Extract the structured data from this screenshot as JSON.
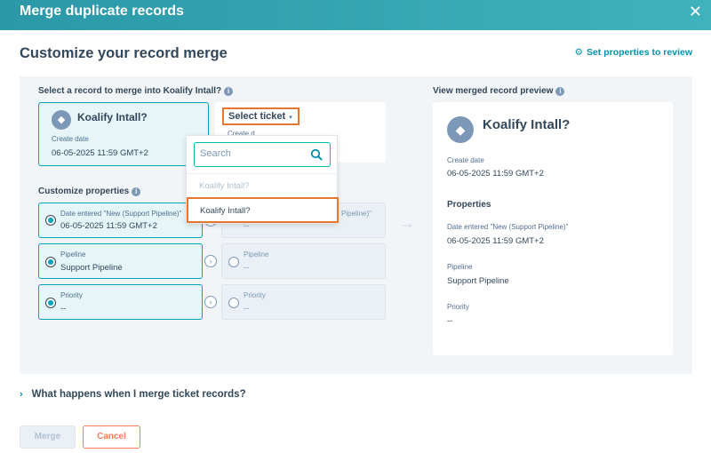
{
  "header": {
    "title": "Merge duplicate records",
    "close_glyph": "✕"
  },
  "page": {
    "title": "Customize your record merge",
    "set_properties_link": "Set properties to review",
    "gear_glyph": "⚙"
  },
  "select_section": {
    "label": "Select a record to merge into Koalify Intall?",
    "primary_record": {
      "title": "Koalify Intall?",
      "date_label": "Create date",
      "date_value": "06-05-2025 11:59 GMT+2"
    },
    "secondary_record": {
      "select_label": "Select ticket",
      "date_label_partial": "Create d"
    }
  },
  "dropdown": {
    "search_placeholder": "Search",
    "items": [
      {
        "label": "Koalify Intall?",
        "disabled": true
      },
      {
        "label": "Koalify Intall?",
        "highlighted": true
      }
    ]
  },
  "customize": {
    "label": "Customize properties",
    "rows": [
      {
        "label": "Date entered \"New (Support Pipeline)\"",
        "value": "06-05-2025 11:59 GMT+2",
        "other_label_partial": "Pipeline)\"",
        "other_value": "--"
      },
      {
        "label": "Pipeline",
        "value": "Support Pipeline",
        "other_label": "Pipeline",
        "other_value": "--"
      },
      {
        "label": "Priority",
        "value": "--",
        "other_label": "Priority",
        "other_value": "--"
      }
    ]
  },
  "preview": {
    "label": "View merged record preview",
    "title": "Koalify Intall?",
    "create_date_label": "Create date",
    "create_date_value": "06-05-2025 11:59 GMT+2",
    "properties_heading": "Properties",
    "props": [
      {
        "label": "Date entered \"New (Support Pipeline)\"",
        "value": "06-05-2025 11:59 GMT+2"
      },
      {
        "label": "Pipeline",
        "value": "Support Pipeline"
      },
      {
        "label": "Priority",
        "value": "--"
      }
    ]
  },
  "faq": {
    "text": "What happens when I merge ticket records?",
    "chevron": "›"
  },
  "footer": {
    "merge_label": "Merge",
    "cancel_label": "Cancel"
  },
  "icons": {
    "info": "i",
    "ticket": "◆",
    "arrow_right": "→",
    "chevron_right": "›",
    "caret_down": "▾"
  },
  "colors": {
    "accent": "#00a4bd",
    "header": "#2b98a8",
    "highlight": "#e8772e",
    "cancel": "#ff7a59"
  }
}
